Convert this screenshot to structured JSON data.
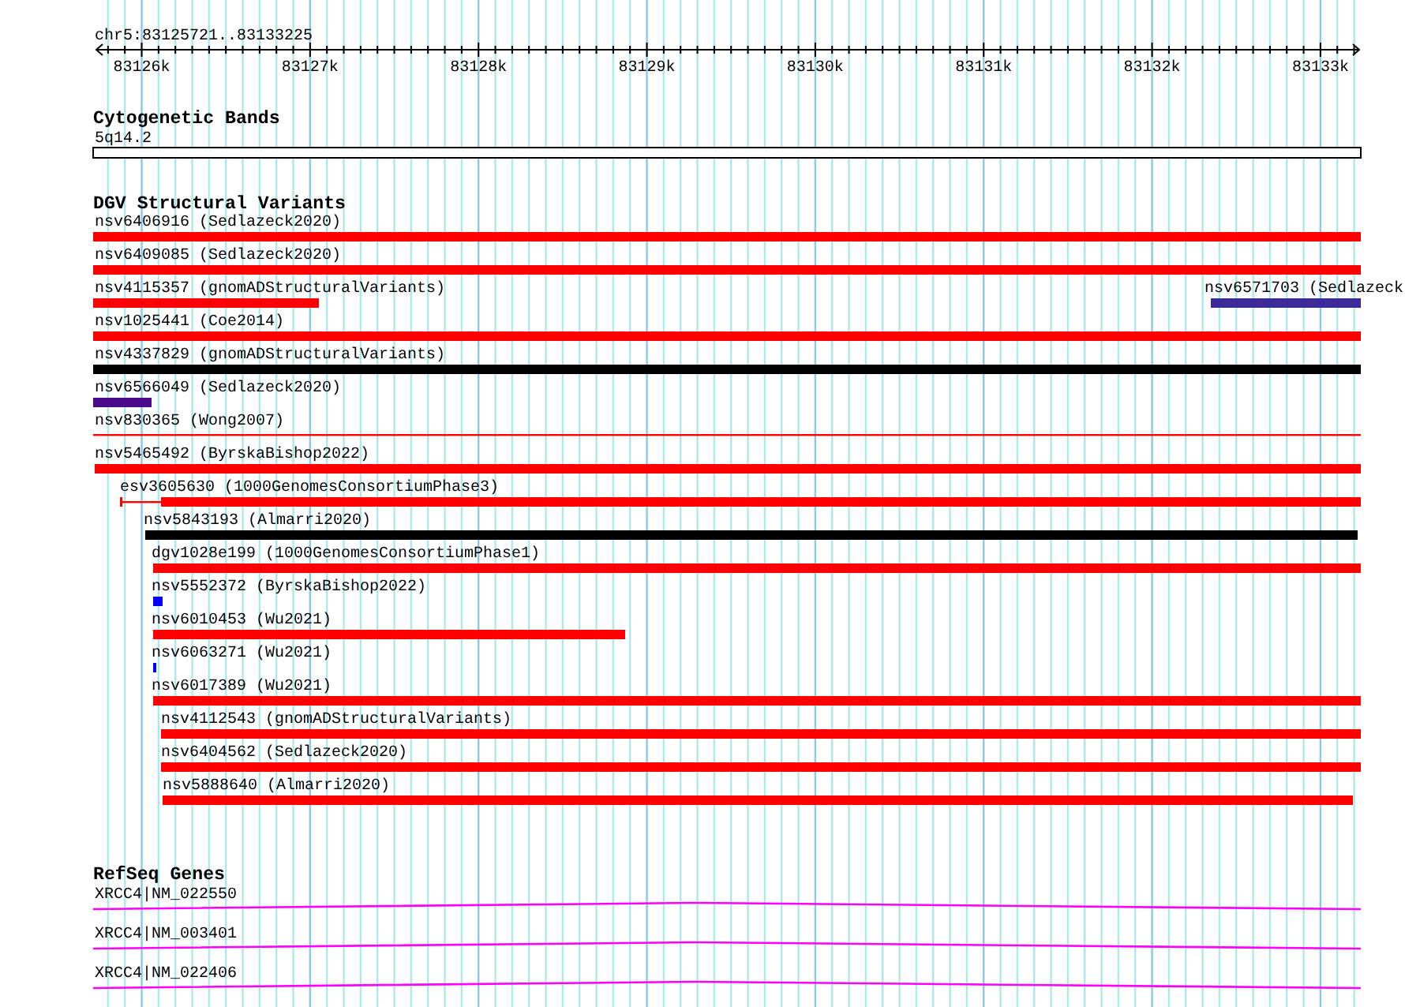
{
  "location": "chr5:83125721..83133225",
  "ruler": {
    "ticks": [
      "83126k",
      "83127k",
      "83128k",
      "83129k",
      "83130k",
      "83131k",
      "83132k",
      "83133k"
    ]
  },
  "cytogenetic_bands": {
    "title": "Cytogenetic Bands",
    "band": "5q14.2"
  },
  "structural_variants": {
    "title": "DGV Structural Variants",
    "rows": [
      {
        "features": [
          {
            "label": "nsv6406916 (Sedlazeck2020)",
            "color": "#ff0000"
          }
        ]
      },
      {
        "features": [
          {
            "label": "nsv6409085 (Sedlazeck2020)",
            "color": "#ff0000"
          }
        ]
      },
      {
        "features": [
          {
            "label": "nsv4115357 (gnomADStructuralVariants)",
            "color": "#ff0000"
          },
          {
            "label": "nsv6571703 (Sedlazeck",
            "color": "#3a2a9a"
          }
        ]
      },
      {
        "features": [
          {
            "label": "nsv1025441 (Coe2014)",
            "color": "#ff0000"
          }
        ]
      },
      {
        "features": [
          {
            "label": "nsv4337829 (gnomADStructuralVariants)",
            "color": "#000000"
          }
        ]
      },
      {
        "features": [
          {
            "label": "nsv6566049 (Sedlazeck2020)",
            "color": "#4b0a8c"
          }
        ]
      },
      {
        "features": [
          {
            "label": "nsv830365 (Wong2007)",
            "color": "#ff0000"
          }
        ]
      },
      {
        "features": [
          {
            "label": "nsv5465492 (ByrskaBishop2022)",
            "color": "#ff0000"
          }
        ]
      },
      {
        "features": [
          {
            "label": "esv3605630 (1000GenomesConsortiumPhase3)",
            "color": "#ff0000"
          }
        ]
      },
      {
        "features": [
          {
            "label": "nsv5843193 (Almarri2020)",
            "color": "#000000"
          }
        ]
      },
      {
        "features": [
          {
            "label": "dgv1028e199 (1000GenomesConsortiumPhase1)",
            "color": "#ff0000"
          }
        ]
      },
      {
        "features": [
          {
            "label": "nsv5552372 (ByrskaBishop2022)",
            "color": "#0000ff"
          }
        ]
      },
      {
        "features": [
          {
            "label": "nsv6010453 (Wu2021)",
            "color": "#ff0000"
          }
        ]
      },
      {
        "features": [
          {
            "label": "nsv6063271 (Wu2021)",
            "color": "#0000ff"
          }
        ]
      },
      {
        "features": [
          {
            "label": "nsv6017389 (Wu2021)",
            "color": "#ff0000"
          }
        ]
      },
      {
        "features": [
          {
            "label": "nsv4112543 (gnomADStructuralVariants)",
            "color": "#ff0000"
          }
        ]
      },
      {
        "features": [
          {
            "label": "nsv6404562 (Sedlazeck2020)",
            "color": "#ff0000"
          }
        ]
      },
      {
        "features": [
          {
            "label": "nsv5888640 (Almarri2020)",
            "color": "#ff0000"
          }
        ]
      }
    ]
  },
  "refseq_genes": {
    "title": "RefSeq Genes",
    "genes": [
      {
        "label": "XRCC4|NM_022550"
      },
      {
        "label": "XRCC4|NM_003401"
      },
      {
        "label": "XRCC4|NM_022406"
      }
    ]
  }
}
